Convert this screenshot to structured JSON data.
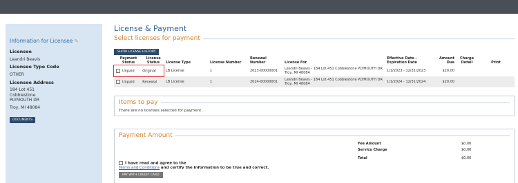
{
  "sidebar": {
    "title": "Information for Licensee",
    "licensee_label": "Licensee",
    "licensee_value": "Leandri Beavis",
    "type_label": "Licensee Type Code",
    "type_value": "OTHER",
    "address_label": "Licensee Address",
    "address_line1": "184 Lot 451",
    "address_line2": "Cobblestone",
    "address_line3": "PLYMOUTH DR",
    "address_city": "Troy, MI 48084",
    "documents_button": "DOCUMENTS"
  },
  "main": {
    "title": "License & Payment",
    "select_section_title": "Select licenses for payment",
    "history_button": "SHOW LICENSE HISTORY",
    "columns": [
      "Payment Status",
      "License Status",
      "License Type",
      "License Number",
      "Renewal Number",
      "License For",
      "Effective Date - Expiration Date",
      "Amount Due",
      "Charge Detail",
      "Print"
    ],
    "rows": [
      {
        "payment_status": "Unpaid",
        "license_status": "Original",
        "license_type": "LB License",
        "license_number": "1",
        "renewal_number": "2023-00000001",
        "license_for": "Leandri Beavis - 184 Lot 451 Cobblestone PLYMOUTH DR Troy, MI 48084",
        "dates": "1/1/2023 - 12/31/2023",
        "amount": "$20.00"
      },
      {
        "payment_status": "Unpaid",
        "license_status": "Renewal",
        "license_type": "LB License",
        "license_number": "1",
        "renewal_number": "2024-00000001",
        "license_for": "Leandri Beavis - 184 Lot 451 Cobblestone PLYMOUTH DR Troy, MI 48084",
        "dates": "1/1/2024 - 12/31/2024",
        "amount": "$20.00"
      }
    ],
    "items_title": "Items to pay",
    "items_empty": "There are no licenses selected for payment.",
    "payment_title": "Payment Amount",
    "fee_label": "Fee Amount",
    "fee_value": "$0.00",
    "service_label": "Service Charge",
    "service_value": "$0.00",
    "total_label": "Total",
    "total_value": "$0.00",
    "agree_prefix": "I have read and agree to the",
    "agree_link": "Terms and Conditions",
    "agree_suffix": "and certify the information to be true and correct.",
    "pay_button": "PAY WITH CREDIT CARD"
  },
  "colors": {
    "accent": "#d9822b",
    "title": "#2f5f92",
    "button": "#2e4a6b",
    "highlight": "#d9333a"
  }
}
